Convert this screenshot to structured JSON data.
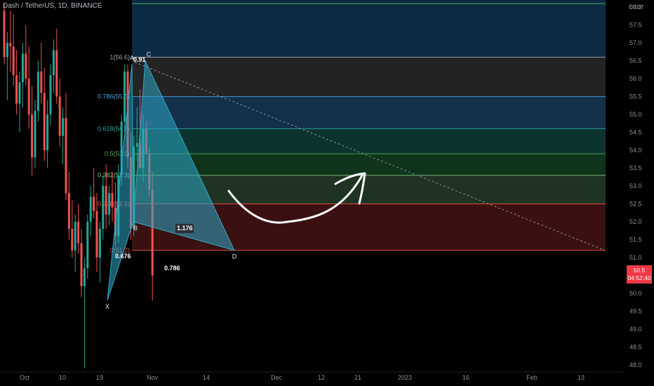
{
  "symbol": "Dash / TetherUS, 1D, BINANCE",
  "axis_unit": "USDT",
  "price_tag": {
    "price": "50.5",
    "countdown": "04:52:40",
    "color": "#f23645"
  },
  "chart_data": {
    "type": "candlestick",
    "ylim": [
      47.8,
      58.2
    ],
    "y_ticks": [
      "58.0",
      "57.5",
      "57.0",
      "56.5",
      "56.0",
      "55.5",
      "55.0",
      "54.5",
      "54.0",
      "53.5",
      "53.0",
      "52.5",
      "52.0",
      "51.5",
      "51.0",
      "50.5",
      "50.0",
      "49.5",
      "49.0",
      "48.5",
      "48.0"
    ],
    "x_ticks": [
      "Oct",
      "10",
      "19",
      "Nov",
      "14",
      "Dec",
      "12",
      "21",
      "2023",
      "16",
      "Feb",
      "13"
    ],
    "colors": {
      "up": "#26a69a",
      "down": "#ef5350"
    },
    "fib_levels": [
      {
        "label": "1(56.6)",
        "price": 56.6,
        "color": "#a0a4ab"
      },
      {
        "label": "0.786(55.5)",
        "price": 55.5,
        "color": "#4aa3e0"
      },
      {
        "label": "0.618(54.6)",
        "price": 54.6,
        "color": "#26a69a"
      },
      {
        "label": "0.5(53.9)",
        "price": 53.9,
        "color": "#4caf50"
      },
      {
        "label": "0.382(53.3)",
        "price": 53.3,
        "color": "#81c784"
      },
      {
        "label": "0.236(52.5)",
        "price": 52.5,
        "color": "#ef5350"
      },
      {
        "label": "0(51.2)",
        "price": 51.2,
        "color": "#ef5350"
      }
    ],
    "pattern_points": [
      {
        "label": "X",
        "price": 49.8
      },
      {
        "label": "A",
        "price": 56.4
      },
      {
        "label": "B",
        "price": 52.0
      },
      {
        "label": "C",
        "price": 56.5
      },
      {
        "label": "D",
        "price": 51.2
      }
    ],
    "ratio_labels": [
      "0.91",
      "0.676",
      "1.176",
      "0.786"
    ],
    "candles": [
      [
        57.9,
        58.1,
        56.4,
        56.6
      ],
      [
        56.6,
        57.3,
        55.4,
        57.0
      ],
      [
        57.0,
        57.9,
        56.2,
        56.9
      ],
      [
        56.9,
        57.8,
        55.8,
        56.1
      ],
      [
        56.1,
        56.8,
        55.0,
        55.3
      ],
      [
        55.3,
        56.2,
        54.5,
        55.9
      ],
      [
        55.9,
        57.0,
        55.2,
        56.7
      ],
      [
        56.7,
        57.5,
        55.8,
        56.0
      ],
      [
        56.0,
        56.9,
        54.6,
        55.0
      ],
      [
        55.0,
        55.8,
        53.3,
        53.8
      ],
      [
        53.8,
        55.4,
        53.5,
        55.1
      ],
      [
        55.1,
        56.5,
        54.8,
        56.2
      ],
      [
        56.2,
        57.0,
        55.3,
        55.6
      ],
      [
        55.6,
        56.3,
        53.7,
        54.0
      ],
      [
        54.0,
        55.4,
        53.5,
        55.0
      ],
      [
        55.0,
        56.4,
        54.7,
        56.1
      ],
      [
        56.1,
        57.1,
        55.6,
        56.8
      ],
      [
        56.8,
        57.4,
        55.3,
        55.5
      ],
      [
        55.5,
        56.0,
        54.1,
        54.4
      ],
      [
        54.4,
        55.2,
        53.6,
        54.9
      ],
      [
        54.9,
        55.6,
        52.6,
        52.8
      ],
      [
        52.8,
        53.4,
        51.5,
        51.8
      ],
      [
        51.8,
        52.6,
        51.0,
        51.2
      ],
      [
        51.2,
        52.2,
        50.6,
        52.0
      ],
      [
        52.0,
        52.5,
        51.1,
        51.4
      ],
      [
        51.4,
        51.8,
        49.9,
        50.2
      ],
      [
        50.2,
        51.0,
        47.9,
        50.7
      ],
      [
        50.7,
        52.2,
        50.4,
        52.0
      ],
      [
        52.0,
        53.0,
        51.6,
        52.7
      ],
      [
        52.7,
        53.5,
        52.1,
        52.3
      ],
      [
        52.3,
        52.8,
        50.6,
        51.0
      ],
      [
        51.0,
        52.0,
        50.3,
        51.8
      ],
      [
        51.8,
        53.3,
        51.5,
        53.0
      ],
      [
        53.0,
        53.6,
        51.8,
        52.2
      ],
      [
        52.2,
        53.0,
        51.9,
        52.8
      ],
      [
        52.8,
        53.4,
        52.0,
        52.4
      ],
      [
        52.4,
        53.1,
        51.3,
        51.6
      ],
      [
        51.6,
        53.6,
        51.4,
        53.3
      ],
      [
        53.3,
        55.0,
        53.0,
        54.8
      ],
      [
        54.8,
        56.4,
        54.3,
        56.2
      ],
      [
        56.2,
        56.4,
        53.5,
        53.8
      ],
      [
        53.8,
        54.5,
        51.5,
        51.8
      ],
      [
        51.8,
        54.4,
        51.6,
        54.1
      ],
      [
        54.1,
        55.2,
        53.7,
        54.2
      ],
      [
        54.2,
        55.7,
        53.9,
        53.5
      ],
      [
        53.5,
        55.0,
        53.1,
        54.6
      ],
      [
        54.6,
        54.8,
        53.9,
        53.9
      ],
      [
        53.9,
        54.1,
        52.7,
        52.9
      ],
      [
        52.9,
        53.4,
        49.8,
        50.5
      ]
    ]
  }
}
